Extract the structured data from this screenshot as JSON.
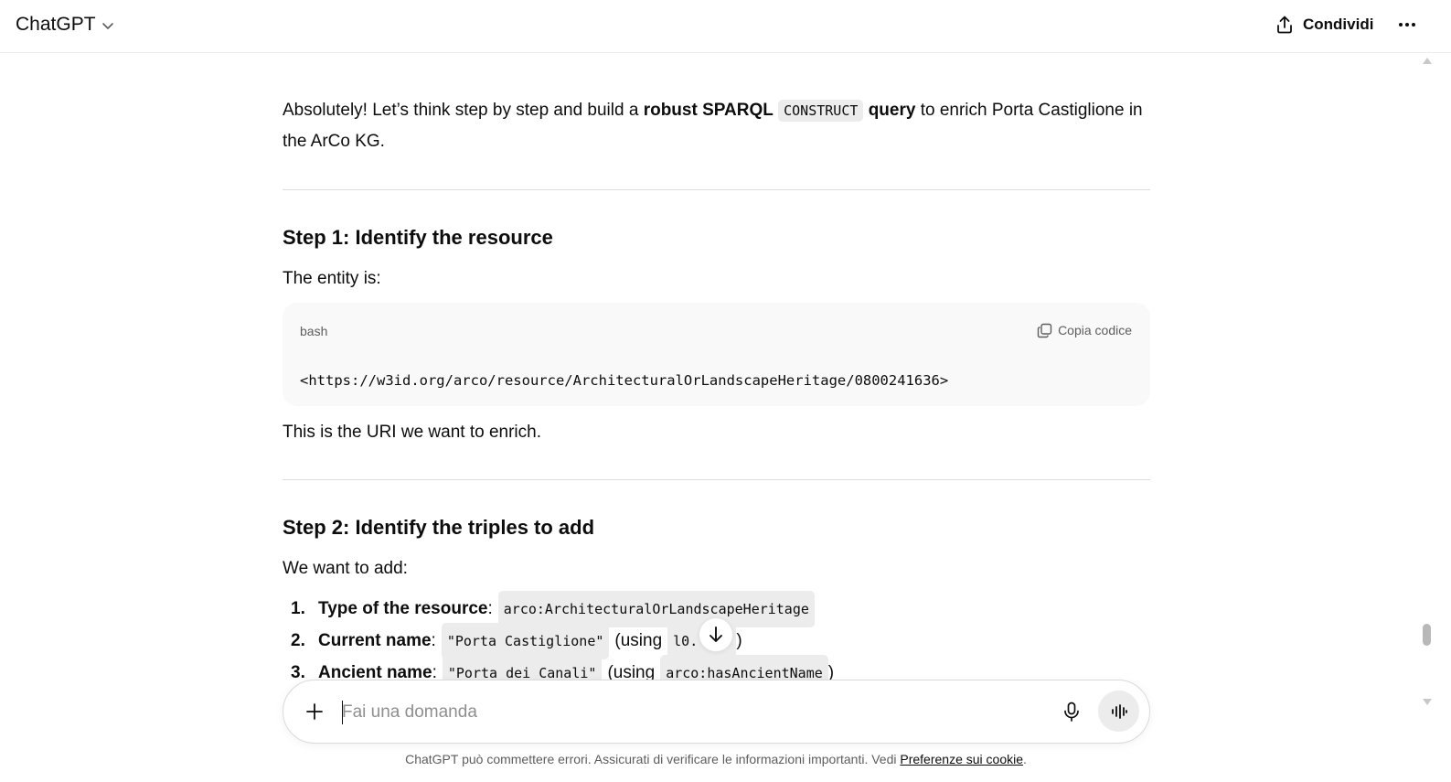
{
  "header": {
    "model_label": "ChatGPT",
    "share_label": "Condividi"
  },
  "message": {
    "intro": {
      "part1": "Absolutely! Let’s think step by step and build a ",
      "bold1": "robust SPARQL",
      "code": "CONSTRUCT",
      "bold2": "query",
      "part2": " to enrich Porta Castiglione in the ArCo KG."
    },
    "step1": {
      "heading": "Step 1: Identify the resource",
      "lead": "The entity is:",
      "code_lang": "bash",
      "copy_label": "Copia codice",
      "code": "<https://w3id.org/arco/resource/ArchitecturalOrLandscapeHeritage/0800241636>",
      "after": "This is the URI we want to enrich."
    },
    "step2": {
      "heading": "Step 2: Identify the triples to add",
      "lead": "We want to add:",
      "items": [
        {
          "num": "1.",
          "label": "Type of the resource",
          "sep": ":",
          "code": "arco:ArchitecturalOrLandscapeHeritage",
          "pre": "",
          "code2": "",
          "post": ""
        },
        {
          "num": "2.",
          "label": "Current name",
          "sep": ":",
          "code": "\"Porta Castiglione\"",
          "pre": "(using",
          "code2": "l0.   e",
          "post": ")"
        },
        {
          "num": "3.",
          "label": "Ancient name",
          "sep": ":",
          "code": "\"Porta dei Canali\"",
          "pre": "(using",
          "code2": "arco:hasAncientName",
          "post": ")"
        }
      ]
    }
  },
  "composer": {
    "placeholder": "Fai una domanda"
  },
  "footer": {
    "text": "ChatGPT può commettere errori. Assicurati di verificare le informazioni importanti. Vedi ",
    "link": "Preferenze sui cookie",
    "end": "."
  }
}
